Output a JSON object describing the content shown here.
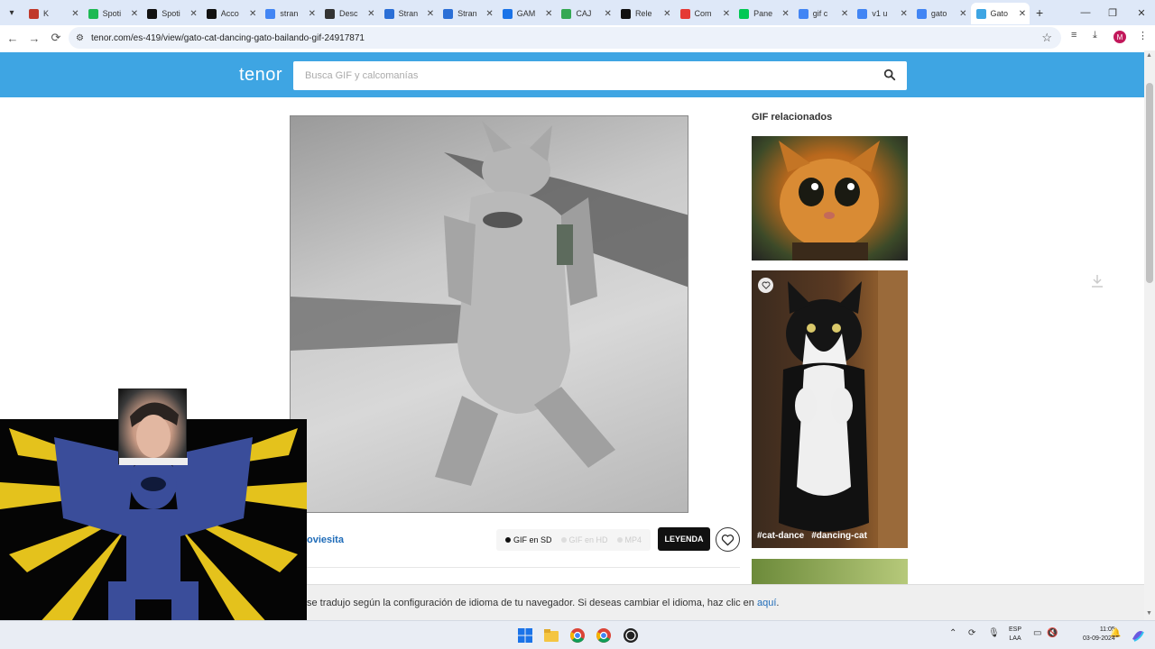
{
  "browser": {
    "tabs": [
      {
        "label": "K",
        "color": "#c0392b",
        "active": false
      },
      {
        "label": "Spoti",
        "color": "#1db954",
        "active": false
      },
      {
        "label": "Spoti",
        "color": "#111111",
        "active": false
      },
      {
        "label": "Acco",
        "color": "#111111",
        "active": false
      },
      {
        "label": "stran",
        "color": "#4285f4",
        "active": false
      },
      {
        "label": "Desc",
        "color": "#333333",
        "active": false
      },
      {
        "label": "Stran",
        "color": "#2b6fd6",
        "active": false
      },
      {
        "label": "Stran",
        "color": "#2b6fd6",
        "active": false
      },
      {
        "label": "GAM",
        "color": "#1a73e8",
        "active": false
      },
      {
        "label": "CAJ",
        "color": "#34a853",
        "active": false
      },
      {
        "label": "Rele",
        "color": "#111111",
        "active": false
      },
      {
        "label": "Com",
        "color": "#e53935",
        "active": false
      },
      {
        "label": "Pane",
        "color": "#00c853",
        "active": false
      },
      {
        "label": "gif c",
        "color": "#4285f4",
        "active": false
      },
      {
        "label": "v1 u",
        "color": "#4285f4",
        "active": false
      },
      {
        "label": "gato",
        "color": "#4285f4",
        "active": false
      },
      {
        "label": "Gato",
        "color": "#3ea5e3",
        "active": true
      }
    ],
    "url": "tenor.com/es-419/view/gato-cat-dancing-gato-bailando-gif-24917871",
    "profile_initial": "M"
  },
  "header": {
    "logo": "tenor",
    "search_placeholder": "Busca GIF y calcomanías"
  },
  "gif": {
    "author_fragment": "oviesita",
    "formats": [
      {
        "label": "GIF en SD",
        "selected": true
      },
      {
        "label": "GIF en HD",
        "selected": false
      },
      {
        "label": "MP4",
        "selected": false
      }
    ],
    "caption_button": "LEYENDA"
  },
  "related": {
    "title": "GIF relacionados",
    "tags": [
      "#cat-dance",
      "#dancing-cat"
    ]
  },
  "translate_bar": {
    "text": "se tradujo según la configuración de idioma de tu navegador. Si deseas cambiar el idioma, haz clic en ",
    "link": "aquí",
    "end": "."
  },
  "taskbar": {
    "lang_top": "ESP",
    "lang_bottom": "LAA",
    "time": "11:05",
    "date": "03-09-2024"
  },
  "colors": {
    "tenor_blue": "#3ea5e3",
    "link_blue": "#1e6bb8",
    "tab_strip": "#dee8f8"
  }
}
